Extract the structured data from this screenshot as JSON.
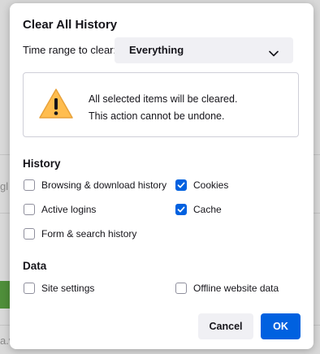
{
  "background": {
    "fragment_1": "gl",
    "fragment_2": "a.v"
  },
  "dialog": {
    "title": "Clear All History",
    "time_range": {
      "label": "Time range to clear:",
      "selected": "Everything",
      "icon": "chevron-down-icon"
    },
    "warning": {
      "icon": "warning-icon",
      "line1": "All selected items will be cleared.",
      "line2": "This action cannot be undone."
    },
    "history": {
      "heading": "History",
      "items": [
        {
          "label": "Browsing & download history",
          "checked": false
        },
        {
          "label": "Cookies",
          "checked": true
        },
        {
          "label": "Active logins",
          "checked": false
        },
        {
          "label": "Cache",
          "checked": true
        },
        {
          "label": "Form & search history",
          "checked": false
        }
      ]
    },
    "data": {
      "heading": "Data",
      "items": [
        {
          "label": "Site settings",
          "checked": false
        },
        {
          "label": "Offline website data",
          "checked": false
        }
      ]
    },
    "buttons": {
      "cancel": "Cancel",
      "ok": "OK"
    },
    "colors": {
      "accent": "#0061e0",
      "warning": "#ffbd4f"
    }
  }
}
